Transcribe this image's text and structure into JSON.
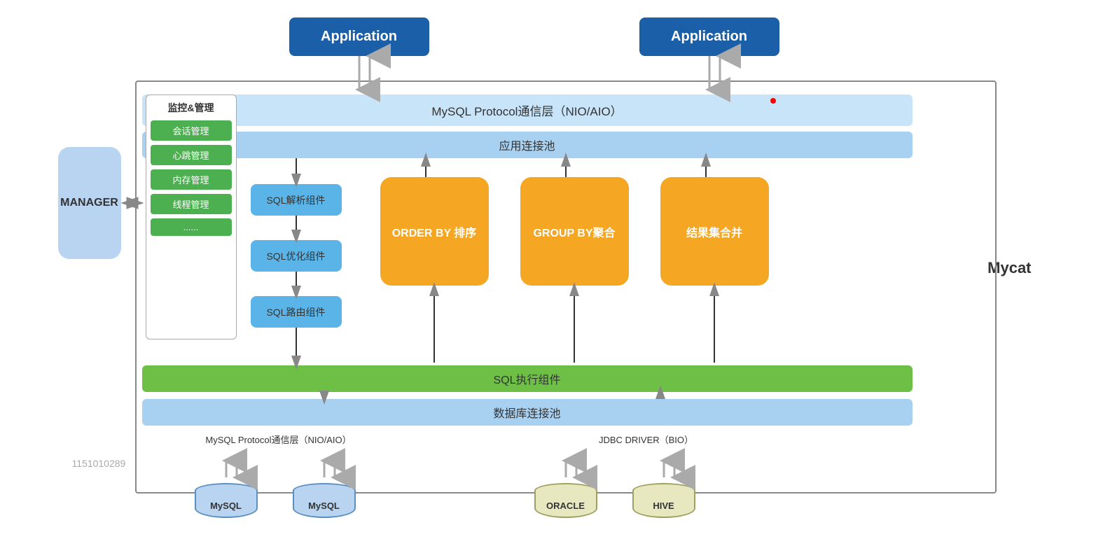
{
  "app1": {
    "label": "Application"
  },
  "app2": {
    "label": "Application"
  },
  "manager": {
    "label": "MANAGER"
  },
  "mycat": {
    "label": "Mycat"
  },
  "watermark": {
    "label": "1151010289"
  },
  "protocol_top": {
    "label": "MySQL Protocol通信层（NIO/AIO）"
  },
  "app_pool": {
    "label": "应用连接池"
  },
  "monitor": {
    "title": "监控&管理",
    "items": [
      "会话管理",
      "心跳管理",
      "内存管理",
      "线程管理",
      "......"
    ]
  },
  "sql_parse": {
    "label": "SQL解析组件"
  },
  "sql_optimize": {
    "label": "SQL优化组件"
  },
  "sql_route": {
    "label": "SQL路由组件"
  },
  "order_by": {
    "label": "ORDER BY 排序"
  },
  "group_by": {
    "label": "GROUP BY聚合"
  },
  "result_merge": {
    "label": "结果集合并"
  },
  "sql_exec": {
    "label": "SQL执行组件"
  },
  "db_pool": {
    "label": "数据库连接池"
  },
  "protocol_bottom_left": {
    "label": "MySQL Protocol通信层（NIO/AIO）"
  },
  "protocol_bottom_right": {
    "label": "JDBC DRIVER（BIO）"
  },
  "db1": {
    "label": "MySQL"
  },
  "db2": {
    "label": "MySQL"
  },
  "db3": {
    "label": "ORACLE"
  },
  "db4": {
    "label": "HIVE"
  }
}
